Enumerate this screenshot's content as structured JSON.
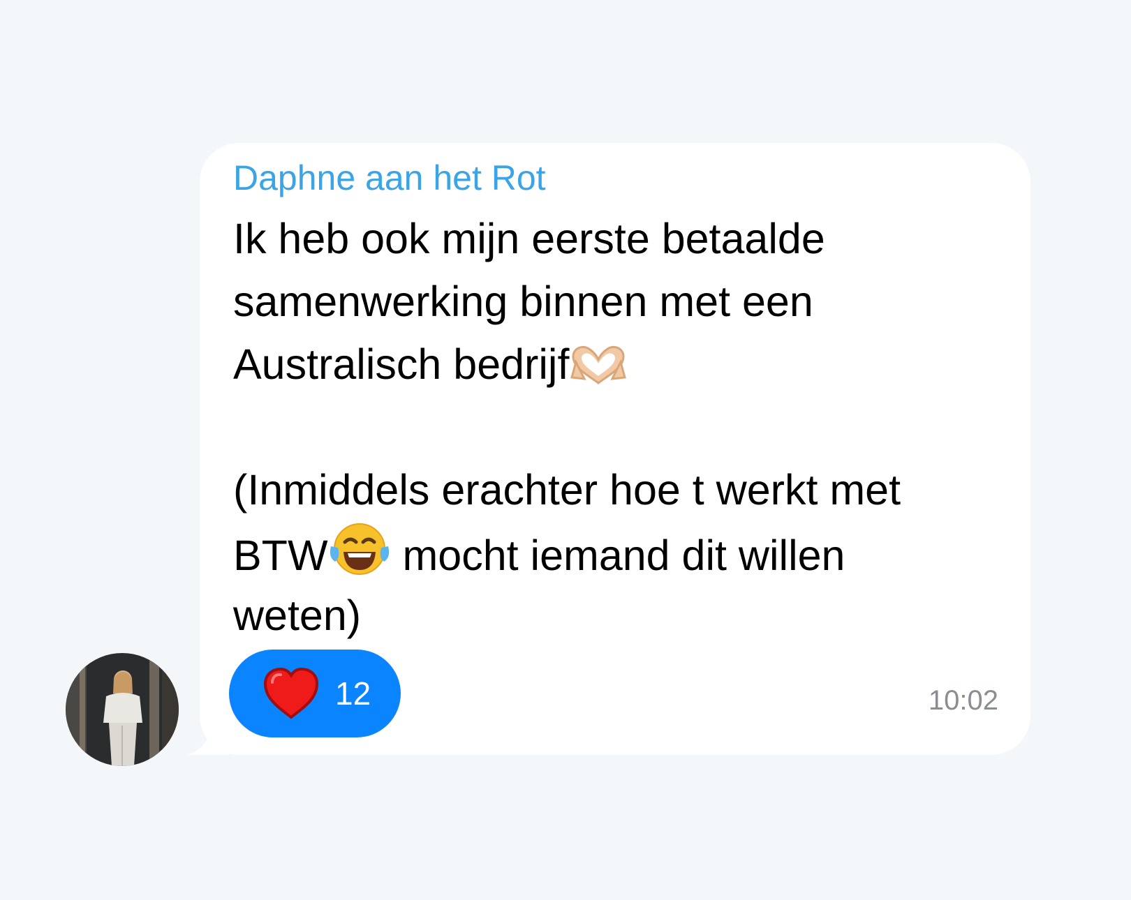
{
  "message": {
    "sender_name": "Daphne aan het Rot",
    "lines": [
      "Ik heb ook mijn eerste betaalde",
      "samenwerking binnen met een",
      "Australisch bedrijf",
      "(Inmiddels erachter hoe t werkt met",
      "BTW",
      " mocht iemand dit willen",
      "weten)"
    ],
    "emojis": [
      "heart-hands-emoji",
      "tears-of-joy-emoji"
    ],
    "time": "10:02",
    "reaction": {
      "emoji": "red-heart-emoji",
      "count": "12",
      "color": "#0a84ff"
    }
  },
  "colors": {
    "background": "#f4f7fa",
    "bubble": "#ffffff",
    "sender": "#3aa4e6",
    "time": "#8a8d91"
  }
}
